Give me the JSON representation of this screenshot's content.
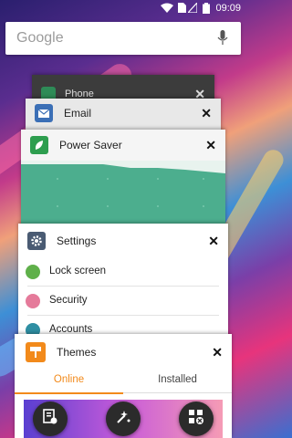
{
  "status_bar": {
    "time": "09:09"
  },
  "search": {
    "placeholder": "Google"
  },
  "cards": {
    "phone": {
      "title": "Phone"
    },
    "email": {
      "title": "Email"
    },
    "power_saver": {
      "title": "Power Saver"
    },
    "settings": {
      "title": "Settings",
      "items": [
        {
          "label": "Lock screen"
        },
        {
          "label": "Security"
        },
        {
          "label": "Accounts"
        }
      ]
    },
    "themes": {
      "title": "Themes",
      "tabs": [
        {
          "label": "Online"
        },
        {
          "label": "Installed"
        }
      ]
    }
  },
  "colors": {
    "email_icon": "#3b6fb6",
    "power_saver_icon": "#2e9e4f",
    "graph_fill": "#4cae8e",
    "settings_icon": "#4a5b73",
    "lock_icon": "#5fb04a",
    "security_icon": "#e57a9a",
    "accounts_icon": "#2f8fa3",
    "themes_accent": "#f28a1b"
  }
}
